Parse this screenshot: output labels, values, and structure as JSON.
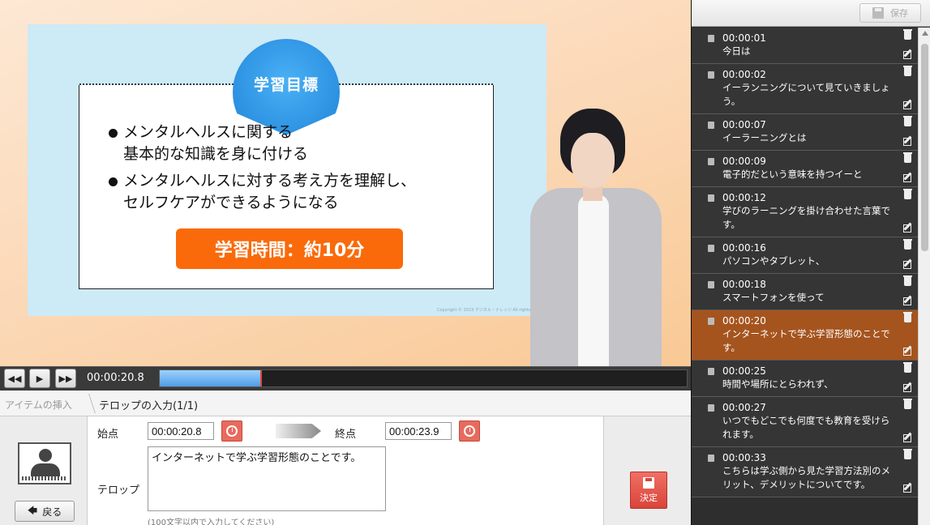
{
  "video": {
    "slide": {
      "badge": "学習目標",
      "bullets": [
        {
          "line1": "メンタルヘルスに関する",
          "line2": "基本的な知識を身に付ける"
        },
        {
          "line1": "メンタルヘルスに対する考え方を理解し、",
          "line2": "セルフケアができるようになる"
        }
      ],
      "time_box": "学習時間：約10分",
      "copyright": "Copyright © 2023 デジタル・ナレッジ All rights reserved."
    },
    "colors": {
      "badge": "#2a8fe0",
      "time_box": "#fa6a0a"
    }
  },
  "player": {
    "rewind_icon": "rewind-icon",
    "play_icon": "play-icon",
    "forward_icon": "fast-forward-icon",
    "current_time": "00:00:20.8",
    "progress": 0.19
  },
  "editor": {
    "tab_insert": "アイテムの挿入",
    "tab_caption": "テロップの入力(1/1)",
    "start_label": "始点",
    "start_value": "00:00:20.8",
    "end_label": "終点",
    "end_value": "00:00:23.9",
    "caption_label": "テロップ",
    "caption_value": "インターネットで学ぶ学習形態のことです。",
    "hint": "(100文字以内で入力してください)",
    "back_label": "戻る",
    "decide_label": "決定"
  },
  "sidebar": {
    "save_label": "保存",
    "active_index": 7,
    "items": [
      {
        "time": "00:00:01",
        "text": "今日は"
      },
      {
        "time": "00:00:02",
        "text": "イーランニングについて見ていきましょう。"
      },
      {
        "time": "00:00:07",
        "text": "イーラーニングとは"
      },
      {
        "time": "00:00:09",
        "text": "電子的だという意味を持つイーと"
      },
      {
        "time": "00:00:12",
        "text": "学びのラーニングを掛け合わせた言葉です。"
      },
      {
        "time": "00:00:16",
        "text": "パソコンやタブレット、"
      },
      {
        "time": "00:00:18",
        "text": "スマートフォンを使って"
      },
      {
        "time": "00:00:20",
        "text": "インターネットで学ぶ学習形態のことです。"
      },
      {
        "time": "00:00:25",
        "text": "時間や場所にとらわれず、"
      },
      {
        "time": "00:00:27",
        "text": "いつでもどこでも何度でも教育を受けられます。"
      },
      {
        "time": "00:00:33",
        "text": "こちらは学ぶ側から見た学習方法別のメリット、デメリットについてです。"
      }
    ],
    "colors": {
      "active": "#a5541e",
      "item_bg": "#353535"
    }
  }
}
